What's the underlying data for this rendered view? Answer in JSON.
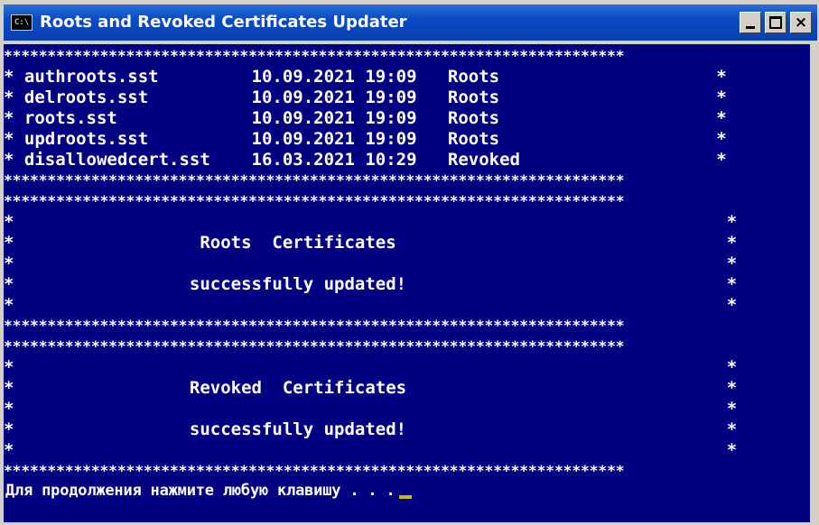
{
  "window": {
    "title": "Roots and Revoked Certificates Updater",
    "icon_label": "C:\\",
    "close_glyph": "×"
  },
  "console": {
    "background": "#000080",
    "foreground": "#ffffff",
    "lines": [
      "***********************************************************************",
      "* authroots.sst         10.09.2021 19:09   Roots                     *",
      "* delroots.sst          10.09.2021 19:09   Roots                     *",
      "* roots.sst             10.09.2021 19:09   Roots                     *",
      "* updroots.sst          10.09.2021 19:09   Roots                     *",
      "* disallowedcert.sst    16.03.2021 10:29   Revoked                   *",
      "***********************************************************************",
      "***********************************************************************",
      "*                                                                     *",
      "*                  Roots  Certificates                                *",
      "*                                                                     *",
      "*                 successfully updated!                               *",
      "*                                                                     *",
      "***********************************************************************",
      "***********************************************************************",
      "*                                                                     *",
      "*                 Revoked  Certificates                               *",
      "*                                                                     *",
      "*                 successfully updated!                               *",
      "*                                                                     *",
      "***********************************************************************"
    ],
    "prompt": "Для продолжения нажмите любую клавишу . . ."
  }
}
